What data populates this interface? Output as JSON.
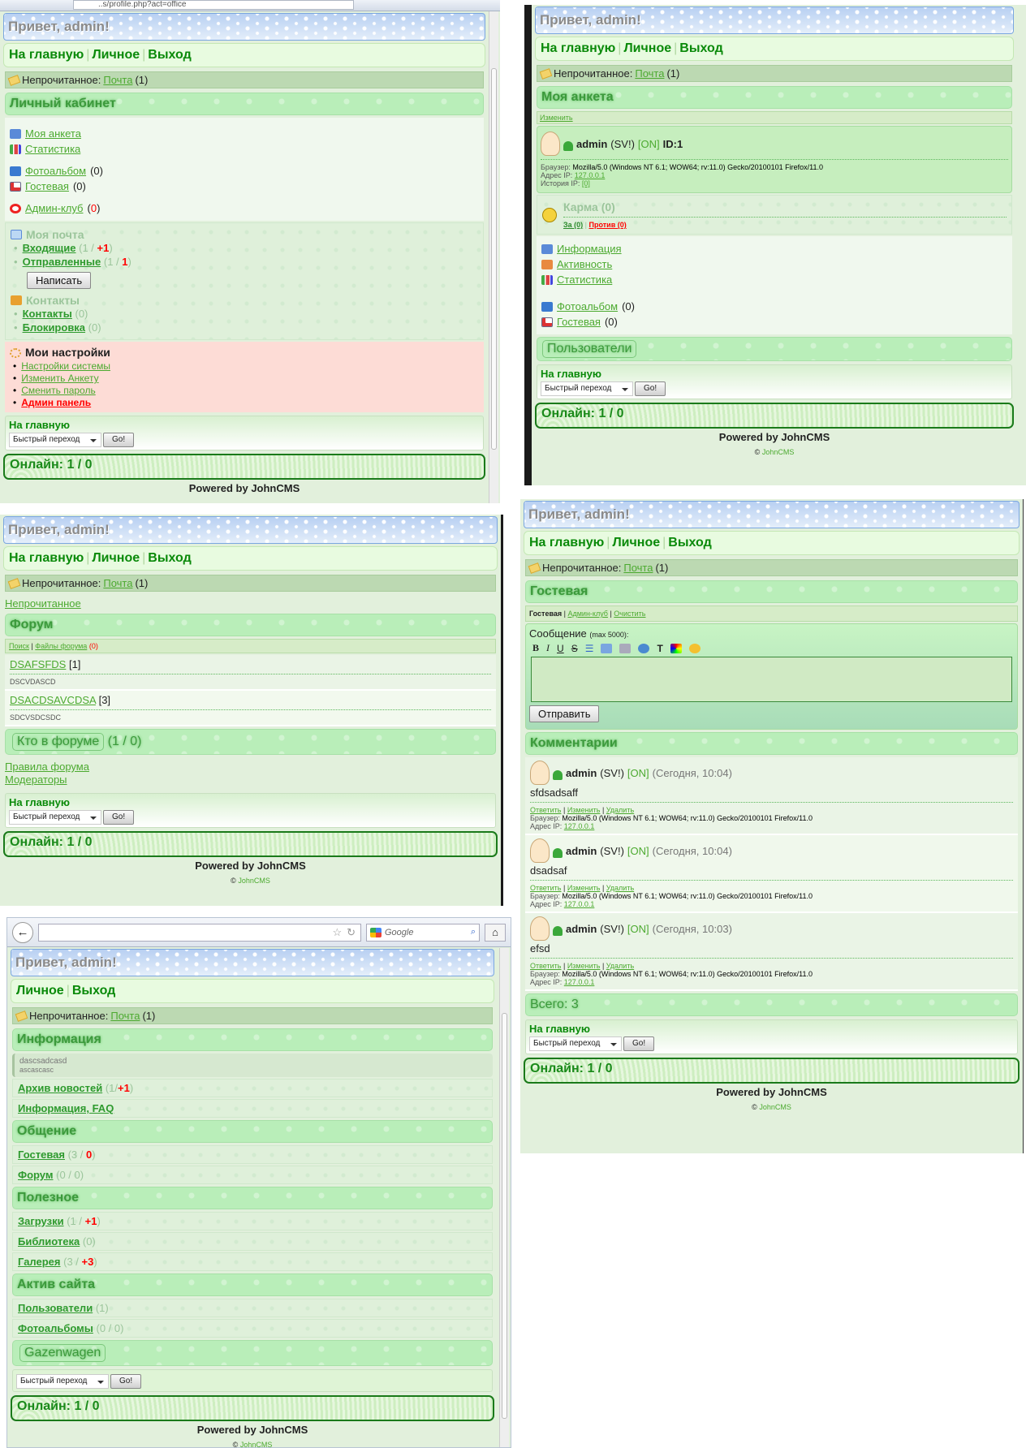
{
  "common": {
    "greeting": "Привет, admin!",
    "nav_home": "На главную",
    "nav_personal": "Личное",
    "nav_exit": "Выход",
    "unread_label": "Непрочитанное:",
    "unread_link": "Почта",
    "unread_count": "(1)",
    "quick_title": "На главную",
    "quick_select": "Быстрый переход",
    "go": "Go!",
    "online": "Онлайн: 1 / 0",
    "powered": "Powered by JohnCMS",
    "copy_sign": "©",
    "copy_link": "JohnCMS"
  },
  "panel1": {
    "url": "..s/profile.php?act=office",
    "title": "Личный кабинет",
    "menu": [
      {
        "label": "Моя анкета",
        "count": ""
      },
      {
        "label": "Статистика",
        "count": ""
      },
      {
        "label": "Фотоальбом",
        "count": "(0)"
      },
      {
        "label": "Гостевая",
        "count": "(0)"
      },
      {
        "label": "Админ-клуб",
        "count": "0"
      }
    ],
    "mail_title": "Моя почта",
    "inbox": {
      "label": "Входящие",
      "a": "(1 / ",
      "b": "+1",
      "c": ")"
    },
    "sent": {
      "label": "Отправленные",
      "a": "(1 / ",
      "b": "1",
      "c": ")"
    },
    "write": "Написать",
    "contacts_title": "Контакты",
    "contacts": {
      "label": "Контакты",
      "count": "(0)"
    },
    "block": {
      "label": "Блокировка",
      "count": "(0)"
    },
    "settings_title": "Мои настройки",
    "settings": [
      "Настройки системы",
      "Изменить Анкету",
      "Сменить пароль",
      "Админ панель"
    ]
  },
  "panel2": {
    "title": "Моя анкета",
    "edit": "Изменить",
    "user": {
      "name": "admin",
      "rights": "(SV!)",
      "status": "[ON]",
      "id": "ID:1"
    },
    "browser_label": "Браузер:",
    "browser": "Mozilla/5.0 (Windows NT 6.1; WOW64; rv:11.0) Gecko/20100101 Firefox/11.0",
    "ip_label": "Адрес IP:",
    "ip": "127.0.0.1",
    "iphist_label": "История IP:",
    "iphist": "[0]",
    "karma": "Карма (0)",
    "karma_for": "За (0)",
    "karma_against": "Против (0)",
    "menu": [
      "Информация",
      "Активность",
      "Статистика"
    ],
    "photo": {
      "label": "Фотоальбом",
      "count": "(0)"
    },
    "guest": {
      "label": "Гостевая",
      "count": "(0)"
    },
    "users_btn": "Пользователи"
  },
  "panel3": {
    "unread_link": "Непрочитанное",
    "title": "Форум",
    "search": "Поиск",
    "files": "Файлы форума",
    "files_count": "(0)",
    "topics": [
      {
        "name": "DSAFSFDS",
        "count": "[1]",
        "desc": "DSCVDASCD"
      },
      {
        "name": "DSACDSAVCDSA",
        "count": "[3]",
        "desc": "SDCVSDCSDC"
      }
    ],
    "who": "Кто в форуме",
    "who_count": "(1 / 0)",
    "rules": "Правила форума",
    "mods": "Модераторы"
  },
  "panel4": {
    "title": "Гостевая",
    "tabs": {
      "current": "Гостевая",
      "admin": "Админ-клуб",
      "clear": "Очистить"
    },
    "msg_label": "Сообщение",
    "msg_max": "(max 5000):",
    "textarea_value": "",
    "send": "Отправить",
    "comments_title": "Комментарии",
    "actions": {
      "reply": "Ответить",
      "edit": "Изменить",
      "delete": "Удалить"
    },
    "comments": [
      {
        "name": "admin",
        "rights": "(SV!)",
        "status": "[ON]",
        "time": "(Сегодня, 10:04)",
        "text": "sfdsadsaff"
      },
      {
        "name": "admin",
        "rights": "(SV!)",
        "status": "[ON]",
        "time": "(Сегодня, 10:04)",
        "text": "dsadsaf"
      },
      {
        "name": "admin",
        "rights": "(SV!)",
        "status": "[ON]",
        "time": "(Сегодня, 10:03)",
        "text": "efsd"
      }
    ],
    "total": "Всего: 3"
  },
  "panel5": {
    "search_placeholder": "Google",
    "info_title": "Информация",
    "news": {
      "title": "dascsadcasd",
      "text": "ascascasc"
    },
    "archive": {
      "label": "Архив новостей",
      "a": "(1/",
      "b": "+1",
      "c": ")"
    },
    "faq": "Информация, FAQ",
    "comm_title": "Общение",
    "guest": {
      "label": "Гостевая",
      "a": "(3 / ",
      "b": "0",
      "c": ")"
    },
    "forum": {
      "label": "Форум",
      "count": "(0 / 0)"
    },
    "useful_title": "Полезное",
    "downloads": {
      "label": "Загрузки",
      "a": "(1 / ",
      "b": "+1",
      "c": ")"
    },
    "library": {
      "label": "Библиотека",
      "count": "(0)"
    },
    "gallery": {
      "label": "Галерея",
      "a": "(3 / ",
      "b": "+3",
      "c": ")"
    },
    "active_title": "Актив сайта",
    "users": {
      "label": "Пользователи",
      "count": "(1)"
    },
    "albums": {
      "label": "Фотоальбомы",
      "count": "(0 / 0)"
    },
    "gaz": "Gazenwagen"
  }
}
